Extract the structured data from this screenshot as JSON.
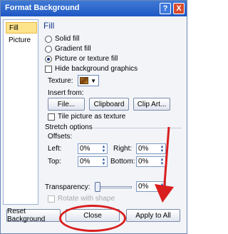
{
  "window": {
    "title": "Format Background",
    "help_glyph": "?",
    "close_glyph": "X"
  },
  "sidebar": {
    "items": [
      {
        "label": "Fill",
        "active": true
      },
      {
        "label": "Picture",
        "active": false
      }
    ]
  },
  "fill": {
    "heading": "Fill",
    "options": [
      {
        "label": "Solid fill",
        "selected": false
      },
      {
        "label": "Gradient fill",
        "selected": false
      },
      {
        "label": "Picture or texture fill",
        "selected": true
      }
    ],
    "hide_background_label": "Hide background graphics",
    "texture_label": "Texture:",
    "insert_from_label": "Insert from:",
    "buttons": {
      "file": "File...",
      "clipboard": "Clipboard",
      "clip_art": "Clip Art..."
    },
    "tile_label": "Tile picture as texture",
    "stretch_label": "Stretch options",
    "offsets_label": "Offsets:",
    "offsets": {
      "left_label": "Left:",
      "left_value": "0%",
      "right_label": "Right:",
      "right_value": "0%",
      "top_label": "Top:",
      "top_value": "0%",
      "bottom_label": "Bottom:",
      "bottom_value": "0%"
    },
    "transparency_label": "Transparency:",
    "transparency_value": "0%",
    "transparency_fraction": 0.0,
    "rotate_label": "Rotate with shape"
  },
  "footer": {
    "reset": "Reset Background",
    "close": "Close",
    "apply_all": "Apply to All"
  },
  "colors": {
    "annotation": "#d91e1e",
    "title_bar": "#1f57c3",
    "active_item": "#fde38a"
  }
}
